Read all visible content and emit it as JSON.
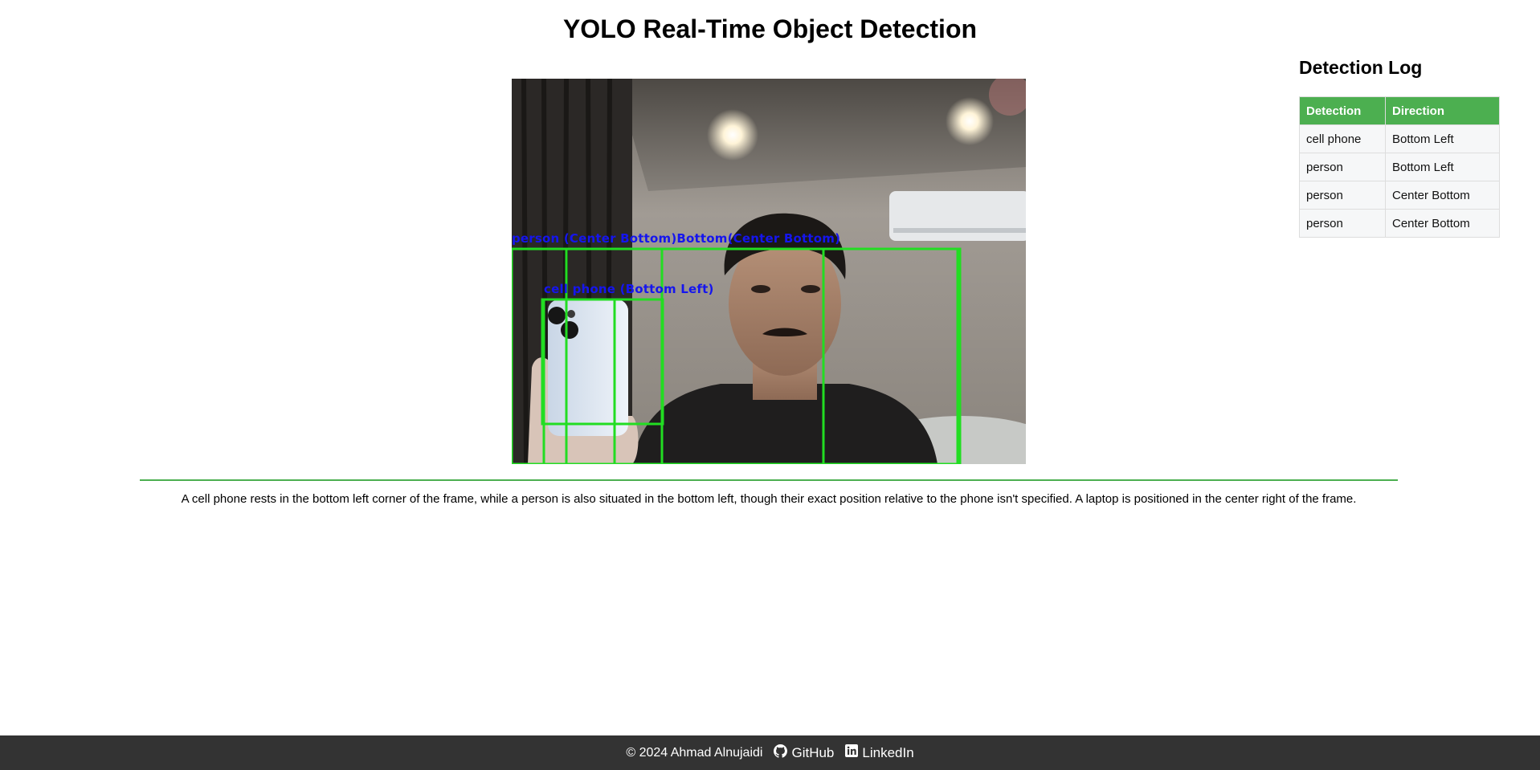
{
  "header": {
    "title": "YOLO Real-Time Object Detection"
  },
  "video": {
    "overlay_labels": {
      "person_row": "person (Center Bottom)Bottom(Center Bottom)",
      "phone_row": "cell phone (Bottom Left)"
    },
    "box_color": "#22dd22",
    "label_color": "#1515ee"
  },
  "log": {
    "heading": "Detection Log",
    "columns": [
      "Detection",
      "Direction"
    ],
    "rows": [
      [
        "cell phone",
        "Bottom Left"
      ],
      [
        "person",
        "Bottom Left"
      ],
      [
        "person",
        "Center Bottom"
      ],
      [
        "person",
        "Center Bottom"
      ]
    ],
    "header_color": "#4caf50"
  },
  "description": "A cell phone rests in the bottom left corner of the frame, while a person is also situated in the bottom left, though their exact position relative to the phone isn't specified. A laptop is positioned in the center right of the frame.",
  "footer": {
    "copyright": "© 2024 Ahmad Alnujaidi",
    "github_label": "GitHub",
    "github_icon": "github-icon",
    "linkedin_label": "LinkedIn",
    "linkedin_icon": "linkedin-icon"
  }
}
